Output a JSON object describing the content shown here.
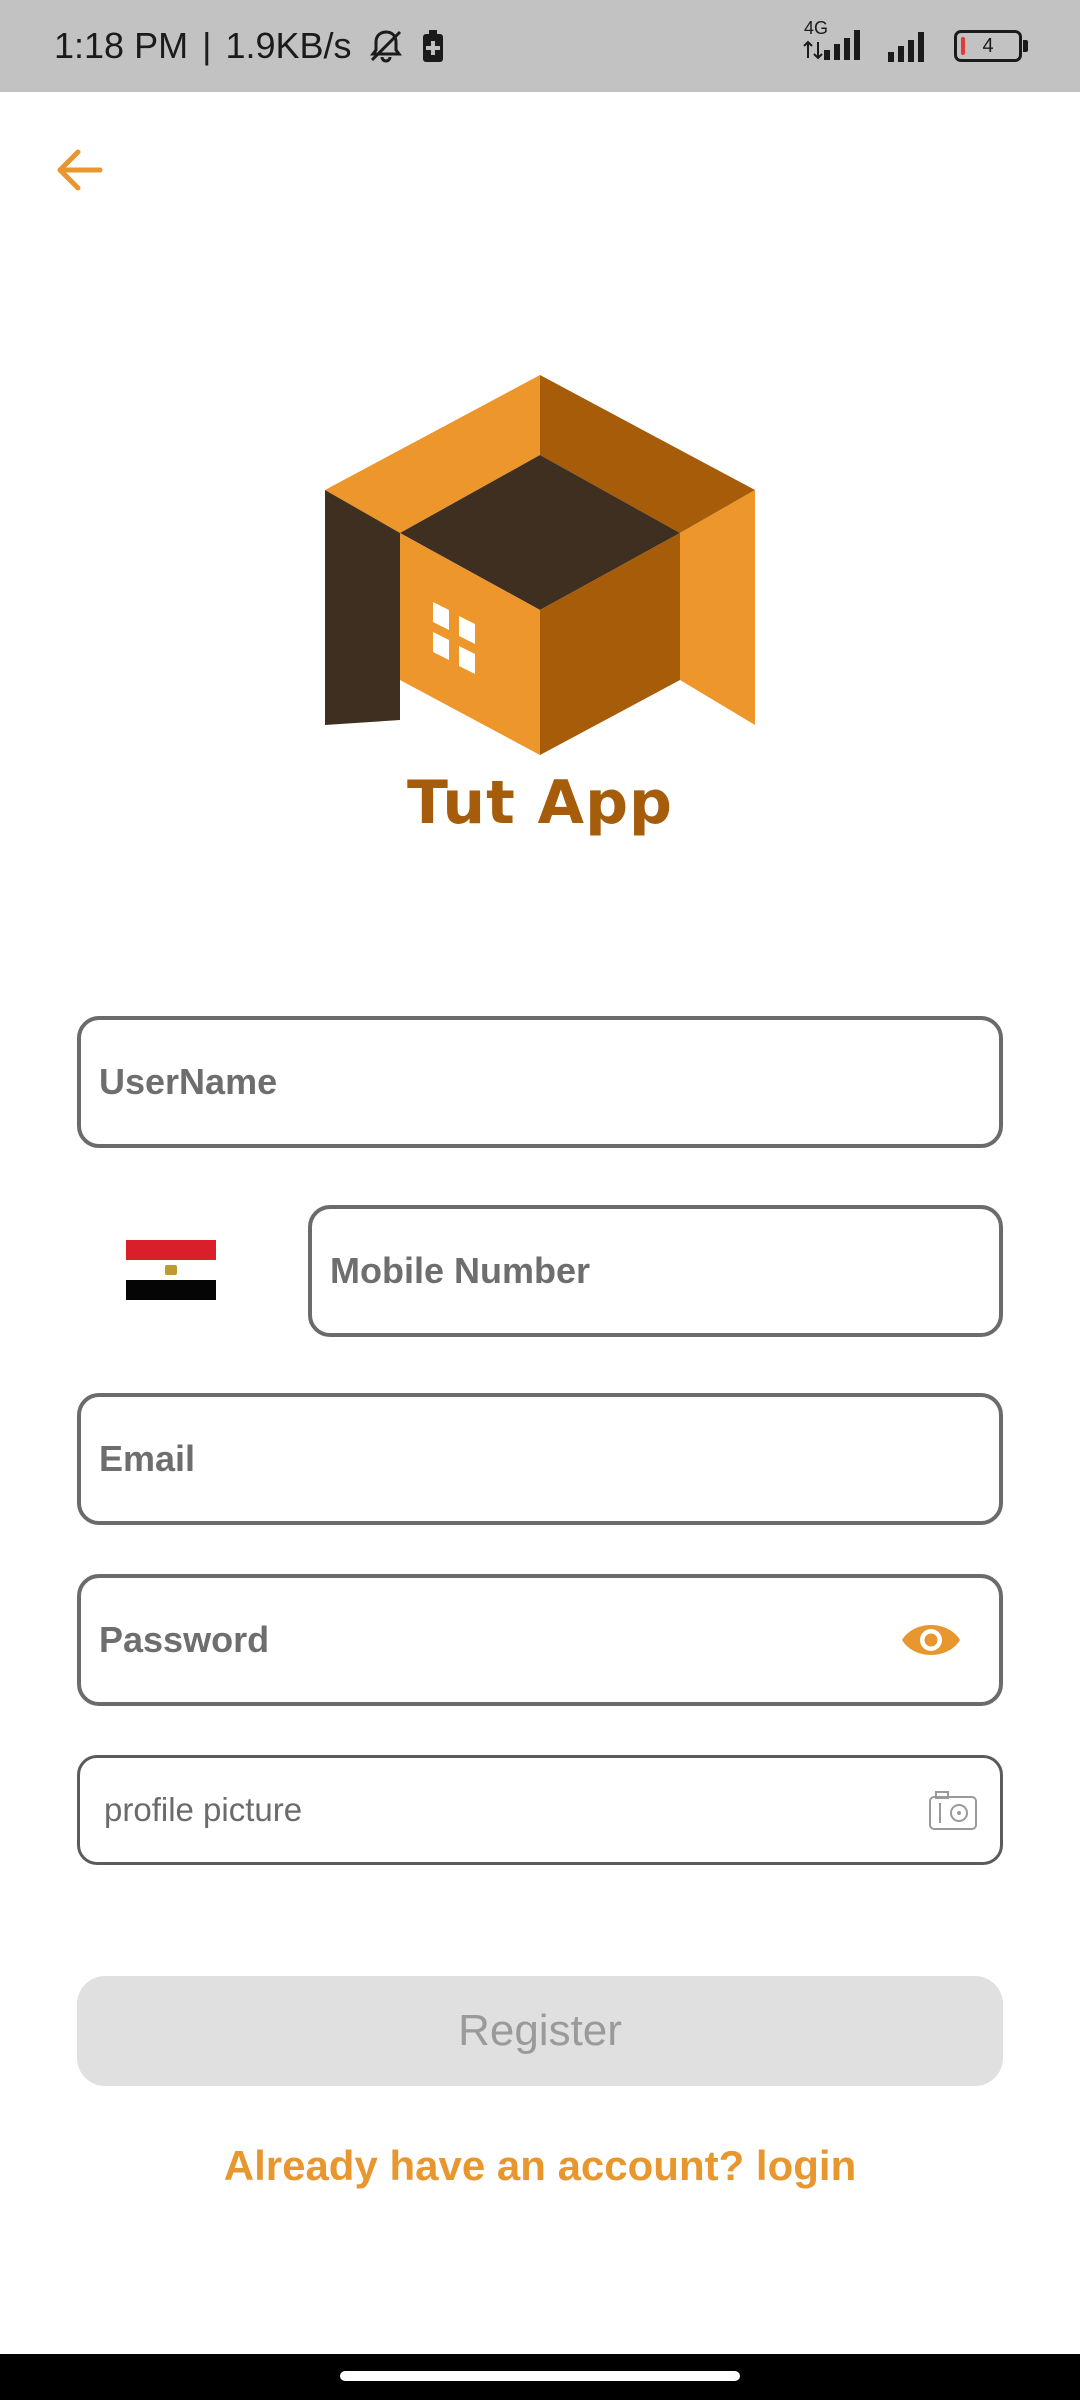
{
  "status_bar": {
    "time": "1:18 PM",
    "separator": "|",
    "net_speed": "1.9KB/s",
    "network_type": "4G",
    "battery_level": "4",
    "icons": [
      "mute-notifications-icon",
      "battery-saver-icon",
      "signal-icon",
      "battery-icon"
    ]
  },
  "header": {
    "back_icon": "arrow-left-icon"
  },
  "brand": {
    "app_name": "Tut App",
    "colors": {
      "light_orange": "#ec962b",
      "dark_orange": "#a65c08",
      "dark_brown": "#3e2f21"
    }
  },
  "form": {
    "username_placeholder": "UserName",
    "mobile_placeholder": "Mobile Number",
    "email_placeholder": "Email",
    "password_placeholder": "Password",
    "profile_picture_label": "profile picture",
    "country_flag": "Egypt"
  },
  "actions": {
    "register_label": "Register",
    "login_link": "Already have an account? login"
  },
  "colors": {
    "accent": "#e8972f",
    "field_border": "#6b6b6b",
    "disabled_button_bg": "#e0e0e0",
    "disabled_button_text": "#9a9a9a"
  }
}
